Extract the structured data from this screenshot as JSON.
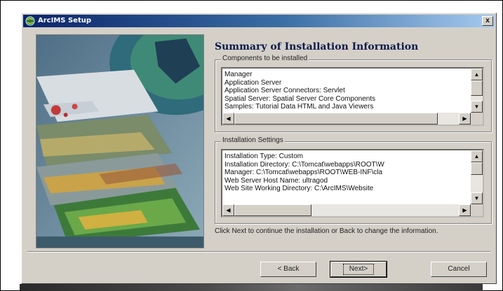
{
  "window": {
    "title": "ArcIMS Setup",
    "close_glyph": "x"
  },
  "main": {
    "heading": "Summary of Installation Information",
    "components": {
      "label": "Components to be installed",
      "items": [
        "Manager",
        "Application Server",
        "Application Server Connectors: Servlet",
        "Spatial Server: Spatial Server Core Components",
        "Samples: Tutorial Data   HTML and Java Viewers"
      ]
    },
    "settings": {
      "label": "Installation Settings",
      "items": [
        "Installation Type:  Custom",
        "Installation Directory: C:\\Tomcat\\webapps\\ROOT\\W",
        "Manager: C:\\Tomcat\\webapps\\ROOT\\WEB-INF\\cla",
        "Web Server Host Name: ultragod",
        "Web Site Working Directory: C:\\ArcIMS\\Website"
      ]
    },
    "hint": "Click Next to continue the installation or Back to change the information."
  },
  "buttons": {
    "back": "< Back",
    "next": "Next>",
    "cancel": "Cancel"
  },
  "icons": {
    "app": "arcims-globe-icon",
    "scroll_up": "scroll-up-arrow-icon",
    "scroll_down": "scroll-down-arrow-icon",
    "scroll_left": "scroll-left-arrow-icon",
    "scroll_right": "scroll-right-arrow-icon"
  }
}
